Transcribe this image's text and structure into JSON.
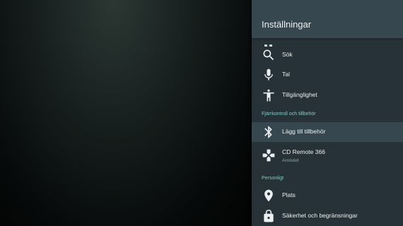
{
  "panel": {
    "title": "Inställningar"
  },
  "items": [
    {
      "label": "Sök",
      "icon": "search-icon"
    },
    {
      "label": "Tal",
      "icon": "microphone-icon"
    },
    {
      "label": "Tillgänglighet",
      "icon": "accessibility-icon"
    }
  ],
  "sections": [
    {
      "title": "Fjärrkontroll och tillbehör",
      "items": [
        {
          "label": "Lägg till tillbehör",
          "icon": "bluetooth-icon",
          "focused": true
        },
        {
          "label": "CD Remote 366",
          "sublabel": "Anslutet",
          "icon": "gamepad-icon"
        }
      ]
    },
    {
      "title": "Personligt",
      "items": [
        {
          "label": "Plats",
          "icon": "location-pin-icon"
        },
        {
          "label": "Säkerhet och begränsningar",
          "icon": "lock-icon"
        }
      ]
    }
  ],
  "colors": {
    "panel_background": "#263238",
    "header_background": "#37474f",
    "focused_row": "#37474f",
    "section_accent": "#80cbc4",
    "text_primary": "#eceff1",
    "text_secondary": "#90a4ae"
  }
}
